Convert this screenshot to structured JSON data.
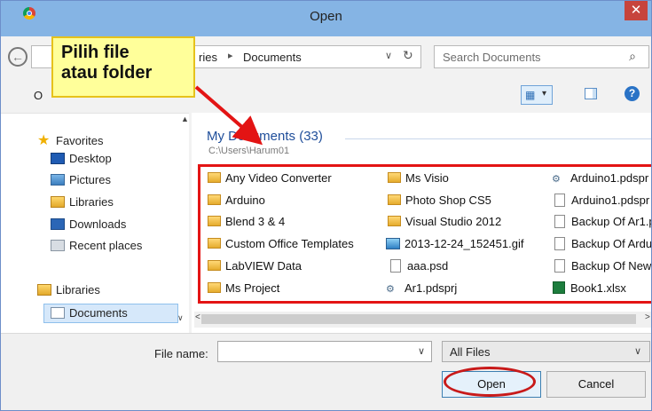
{
  "window": {
    "title": "Open",
    "close_glyph": "✕",
    "app_icon": "chrome-icon"
  },
  "nav": {
    "breadcrumb": [
      "ries",
      "Documents"
    ],
    "search_placeholder": "Search Documents"
  },
  "toolbar": {
    "organize_label": "O"
  },
  "sidebar": {
    "items": [
      {
        "label": "Favorites",
        "icon": "star-icon"
      },
      {
        "label": "Desktop",
        "icon": "desktop-icon"
      },
      {
        "label": "Pictures",
        "icon": "pictures-icon"
      },
      {
        "label": "Libraries",
        "icon": "libraries-icon"
      },
      {
        "label": "Downloads",
        "icon": "downloads-icon"
      },
      {
        "label": "Recent places",
        "icon": "recent-places-icon"
      },
      {
        "label": "Libraries",
        "icon": "libraries-icon"
      },
      {
        "label": "Documents",
        "icon": "documents-icon",
        "selected": true
      }
    ]
  },
  "files": {
    "group_title": "My Documents (33)",
    "group_path": "C:\\Users\\Harum01",
    "col1": [
      {
        "name": "Any Video Converter",
        "type": "folder"
      },
      {
        "name": "Arduino",
        "type": "folder"
      },
      {
        "name": "Blend 3 & 4",
        "type": "folder"
      },
      {
        "name": "Custom Office Templates",
        "type": "folder"
      },
      {
        "name": "LabVIEW Data",
        "type": "folder"
      },
      {
        "name": "Ms Project",
        "type": "folder"
      }
    ],
    "col2": [
      {
        "name": "Ms Visio",
        "type": "folder"
      },
      {
        "name": "Photo Shop CS5",
        "type": "folder"
      },
      {
        "name": "Visual Studio 2012",
        "type": "folder"
      },
      {
        "name": "2013-12-24_152451.gif",
        "type": "image"
      },
      {
        "name": "aaa.psd",
        "type": "document"
      },
      {
        "name": "Ar1.pdsprj",
        "type": "project"
      }
    ],
    "col3": [
      {
        "name": "Arduino1.pdspr",
        "type": "project"
      },
      {
        "name": "Arduino1.pdspr",
        "type": "document"
      },
      {
        "name": "Backup Of Ar1.p",
        "type": "document"
      },
      {
        "name": "Backup Of Ardu",
        "type": "document"
      },
      {
        "name": "Backup Of New",
        "type": "document"
      },
      {
        "name": "Book1.xlsx",
        "type": "excel"
      }
    ]
  },
  "bottom": {
    "file_name_label": "File name:",
    "file_name_value": "",
    "filter_value": "All Files",
    "open_label": "Open",
    "cancel_label": "Cancel"
  },
  "annotation": {
    "callout_line1": "Pilih file",
    "callout_line2": "atau folder",
    "highlight_color": "#e31414"
  }
}
